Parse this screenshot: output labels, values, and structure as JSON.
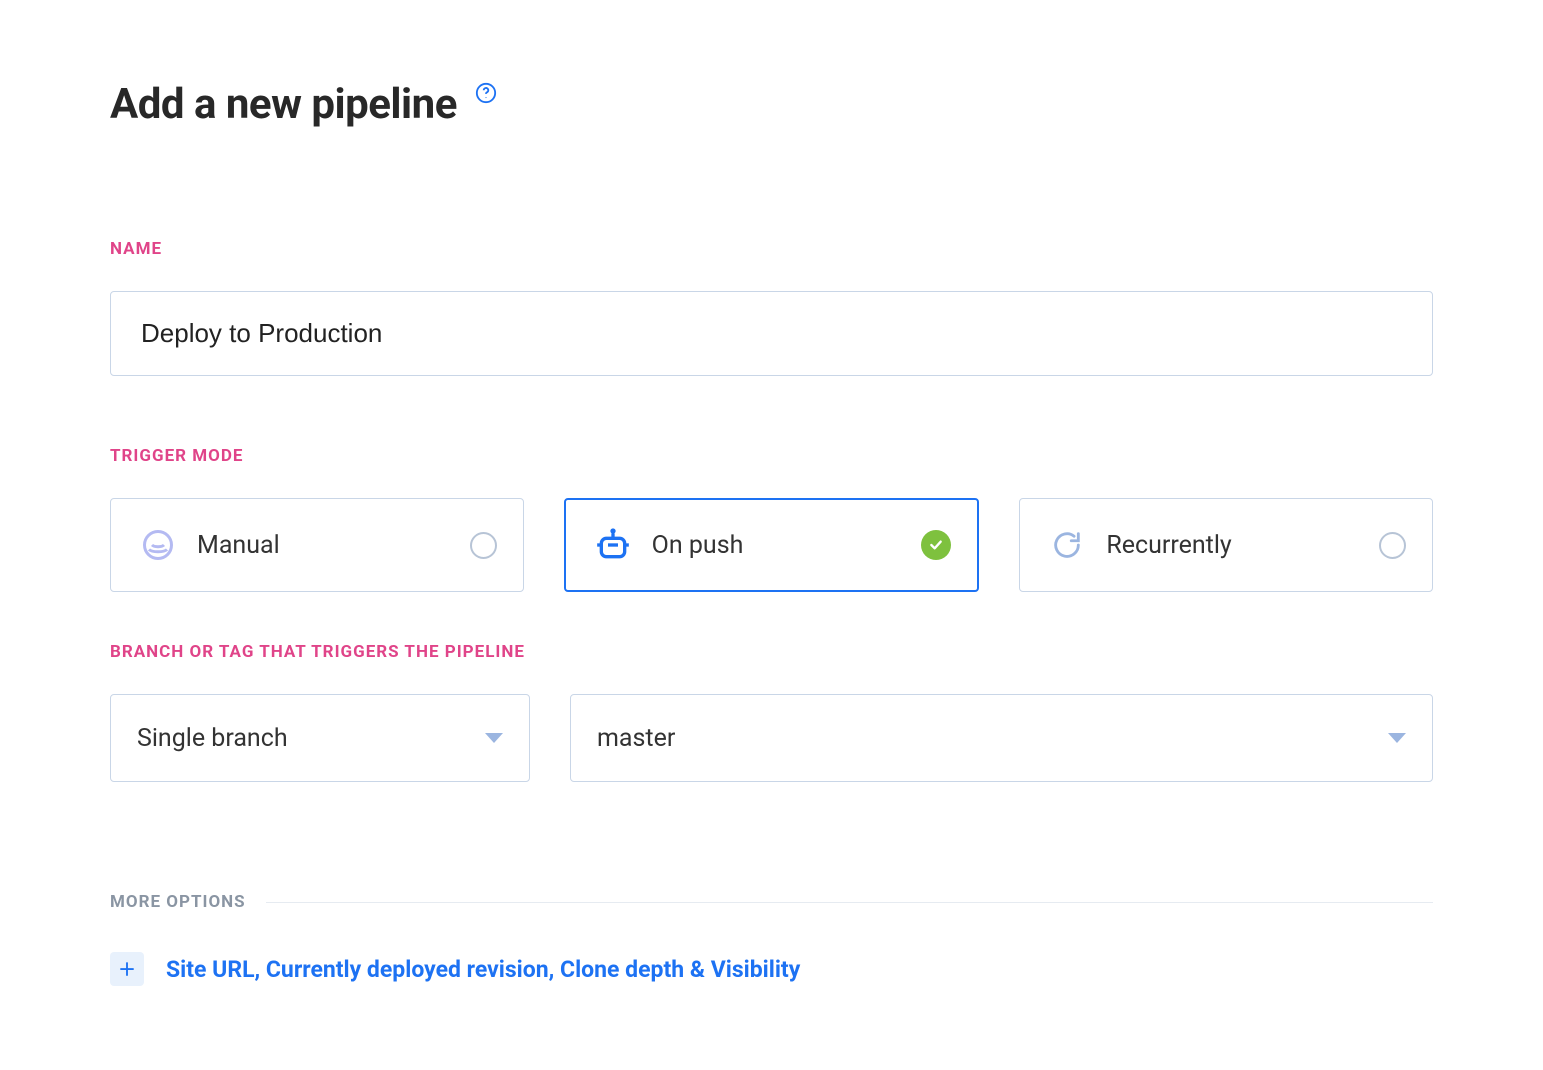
{
  "header": {
    "title": "Add a new pipeline"
  },
  "sections": {
    "name_label": "NAME",
    "trigger_label": "TRIGGER MODE",
    "branch_label": "BRANCH OR TAG THAT TRIGGERS THE PIPELINE",
    "more_label": "MORE OPTIONS"
  },
  "form": {
    "name_value": "Deploy to Production",
    "triggers": {
      "manual": {
        "label": "Manual",
        "selected": false
      },
      "on_push": {
        "label": "On push",
        "selected": true
      },
      "recurrently": {
        "label": "Recurrently",
        "selected": false
      }
    },
    "branch_mode_value": "Single branch",
    "branch_value": "master"
  },
  "more": {
    "expand_label": "Site URL, Currently deployed revision, Clone depth & Visibility"
  },
  "colors": {
    "accent_pink": "#e04489",
    "accent_blue": "#1d72f3",
    "accent_green": "#7ec13e",
    "icon_lavender": "#b4baf2",
    "icon_periwinkle": "#9bb5e0",
    "border": "#c9d6e7"
  }
}
